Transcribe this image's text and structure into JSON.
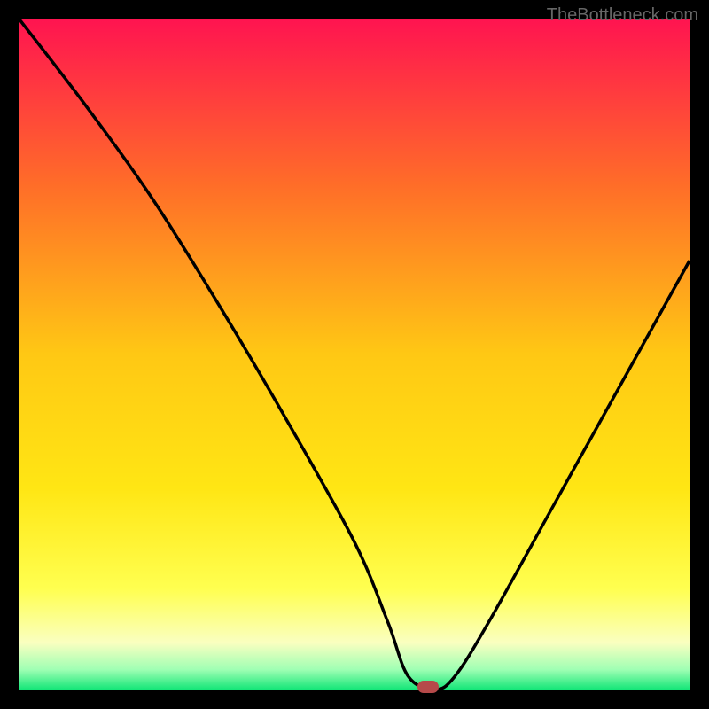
{
  "watermark": "TheBottleneck.com",
  "chart_data": {
    "type": "line",
    "title": "",
    "xlabel": "",
    "ylabel": "",
    "xlim": [
      0,
      100
    ],
    "ylim": [
      0,
      100
    ],
    "x": [
      0,
      10,
      20,
      30,
      40,
      50,
      55,
      58,
      62,
      65,
      70,
      80,
      90,
      100
    ],
    "values": [
      100,
      87,
      73,
      57,
      40,
      22,
      10,
      2,
      0,
      2,
      10,
      28,
      46,
      64
    ],
    "gradient_stops": [
      {
        "offset": 0.0,
        "color": "#ff1450"
      },
      {
        "offset": 0.25,
        "color": "#ff6e28"
      },
      {
        "offset": 0.5,
        "color": "#ffc814"
      },
      {
        "offset": 0.7,
        "color": "#ffe614"
      },
      {
        "offset": 0.85,
        "color": "#ffff50"
      },
      {
        "offset": 0.93,
        "color": "#faffc0"
      },
      {
        "offset": 0.97,
        "color": "#a0ffb4"
      },
      {
        "offset": 1.0,
        "color": "#14e678"
      }
    ],
    "marker": {
      "x": 61,
      "y": 0,
      "color": "#b64a4a"
    }
  }
}
